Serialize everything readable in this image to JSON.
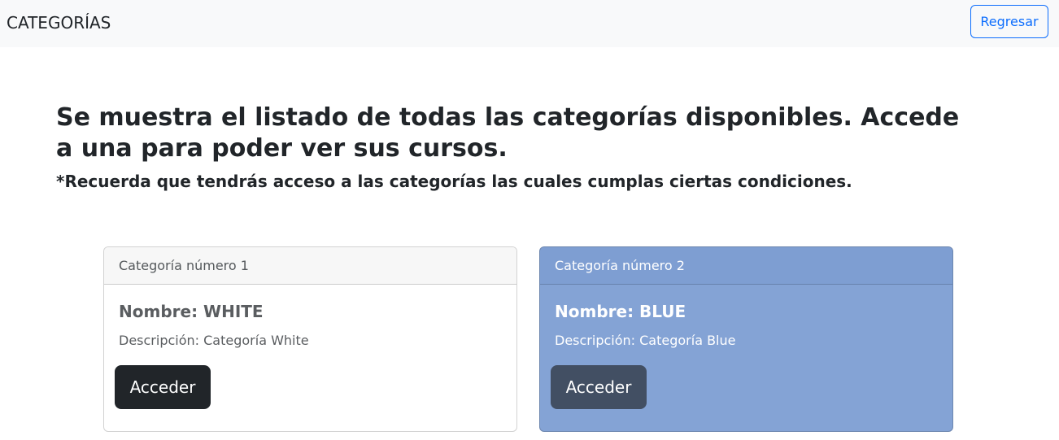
{
  "navbar": {
    "brand": "CATEGORÍAS",
    "back_label": "Regresar"
  },
  "main": {
    "heading": "Se muestra el listado de todas las categorías disponibles. Accede a una para poder ver sus cursos.",
    "subheading": "*Recuerda que tendrás acceso a las categorías las cuales cumplas ciertas condiciones."
  },
  "categories": [
    {
      "header": "Categoría número 1",
      "title": "Nombre: WHITE",
      "description": "Descripción: Categoría White",
      "button_label": "Acceder",
      "background_color": "#ffffff"
    },
    {
      "header": "Categoría número 2",
      "title": "Nombre: BLUE",
      "description": "Descripción: Categoría Blue",
      "button_label": "Acceder",
      "background_color": "#84a3d5"
    }
  ],
  "colors": {
    "navbar_bg": "#f8f9fa",
    "primary_outline": "#0d6efd",
    "dark_button": "#212529"
  }
}
